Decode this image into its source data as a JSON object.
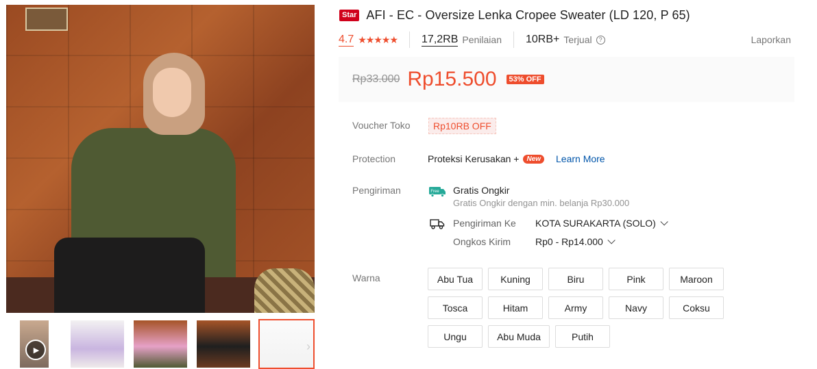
{
  "product": {
    "badge": "Star",
    "title": "AFI - EC - Oversize Lenka Cropee Sweater (LD 120, P 65)"
  },
  "stats": {
    "rating": "4.7",
    "stars": "★★★★★",
    "review_count": "17,2RB",
    "review_label": "Penilaian",
    "sold_count": "10RB+",
    "sold_label": "Terjual",
    "help": "?",
    "report": "Laporkan"
  },
  "price": {
    "original": "Rp33.000",
    "current": "Rp15.500",
    "discount": "53% OFF"
  },
  "voucher": {
    "label": "Voucher Toko",
    "value": "Rp10RB OFF"
  },
  "protection": {
    "label": "Protection",
    "text": "Proteksi Kerusakan +",
    "new_badge": "New",
    "learn_more": "Learn More"
  },
  "shipping": {
    "label": "Pengiriman",
    "free_icon_text": "Free",
    "free_title": "Gratis Ongkir",
    "free_sub": "Gratis Ongkir dengan min. belanja Rp30.000",
    "to_label": "Pengiriman Ke",
    "to_value": "KOTA SURAKARTA (SOLO)",
    "cost_label": "Ongkos Kirim",
    "cost_value": "Rp0 - Rp14.000"
  },
  "variants": {
    "label": "Warna",
    "options": [
      "Abu Tua",
      "Kuning",
      "Biru",
      "Pink",
      "Maroon",
      "Tosca",
      "Hitam",
      "Army",
      "Navy",
      "Coksu",
      "Ungu",
      "Abu Muda",
      "Putih"
    ]
  },
  "colors": {
    "accent": "#ee4d2d",
    "link": "#0055aa",
    "star_badge": "#d0011b"
  }
}
